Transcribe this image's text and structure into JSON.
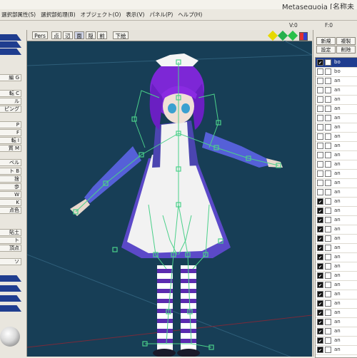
{
  "window": {
    "title": "Metasequoia [名称未"
  },
  "menu": [
    "選択部属性(S)",
    "選択部処理(B)",
    "オブジェクト(O)",
    "表示(V)",
    "パネル(P)",
    "ヘルプ(H)"
  ],
  "toolbar": {
    "v0": "V:0",
    "v1": "F:0"
  },
  "left_commands": [
    "編 G",
    "転 C",
    "ル",
    "ピング",
    "P",
    "F",
    "転 I",
    "質 M",
    "ベル",
    "ト B",
    "捨",
    "歩",
    "W",
    "K",
    "点色",
    "貼土",
    "ト",
    "頂点",
    "ソ"
  ],
  "viewport": {
    "view_buttons": [
      "Pers",
      "点",
      "辺",
      "面",
      "隠",
      "前",
      "下絵"
    ],
    "active_view": "面"
  },
  "right_panel": {
    "buttons": [
      "新規",
      "複製",
      "設定",
      "削除"
    ],
    "objects": [
      {
        "name": "bo",
        "selected": true,
        "visible": true,
        "locked": false
      },
      {
        "name": "bo",
        "selected": false,
        "visible": false,
        "locked": false
      },
      {
        "name": "an",
        "selected": false,
        "visible": false,
        "locked": false
      },
      {
        "name": "an",
        "selected": false,
        "visible": false,
        "locked": false
      },
      {
        "name": "an",
        "selected": false,
        "visible": false,
        "locked": false
      },
      {
        "name": "an",
        "selected": false,
        "visible": false,
        "locked": false
      },
      {
        "name": "an",
        "selected": false,
        "visible": false,
        "locked": false
      },
      {
        "name": "an",
        "selected": false,
        "visible": false,
        "locked": false
      },
      {
        "name": "an",
        "selected": false,
        "visible": false,
        "locked": false
      },
      {
        "name": "an",
        "selected": false,
        "visible": false,
        "locked": false
      },
      {
        "name": "an",
        "selected": false,
        "visible": false,
        "locked": false
      },
      {
        "name": "an",
        "selected": false,
        "visible": false,
        "locked": false
      },
      {
        "name": "an",
        "selected": false,
        "visible": false,
        "locked": false
      },
      {
        "name": "an",
        "selected": false,
        "visible": false,
        "locked": false
      },
      {
        "name": "an",
        "selected": false,
        "visible": false,
        "locked": false
      },
      {
        "name": "an",
        "selected": false,
        "visible": true,
        "locked": false
      },
      {
        "name": "an",
        "selected": false,
        "visible": true,
        "locked": false
      },
      {
        "name": "an",
        "selected": false,
        "visible": true,
        "locked": false
      },
      {
        "name": "an",
        "selected": false,
        "visible": true,
        "locked": false
      },
      {
        "name": "an",
        "selected": false,
        "visible": true,
        "locked": false
      },
      {
        "name": "an",
        "selected": false,
        "visible": true,
        "locked": false
      },
      {
        "name": "an",
        "selected": false,
        "visible": true,
        "locked": false
      },
      {
        "name": "an",
        "selected": false,
        "visible": true,
        "locked": false
      },
      {
        "name": "an",
        "selected": false,
        "visible": true,
        "locked": false
      },
      {
        "name": "an",
        "selected": false,
        "visible": true,
        "locked": false
      },
      {
        "name": "an",
        "selected": false,
        "visible": true,
        "locked": false
      },
      {
        "name": "an",
        "selected": false,
        "visible": true,
        "locked": false
      },
      {
        "name": "an",
        "selected": false,
        "visible": true,
        "locked": false
      },
      {
        "name": "an",
        "selected": false,
        "visible": true,
        "locked": false
      },
      {
        "name": "an",
        "selected": false,
        "visible": true,
        "locked": false
      },
      {
        "name": "an",
        "selected": false,
        "visible": true,
        "locked": false
      },
      {
        "name": "an",
        "selected": false,
        "visible": true,
        "locked": false
      }
    ]
  },
  "colors": {
    "viewport_bg": "#173e56",
    "accent_blue": "#1f3d8f",
    "bone_green": "#4bd08a",
    "hair_purple": "#8a2be2",
    "sleeve_blue": "#5560d8"
  }
}
